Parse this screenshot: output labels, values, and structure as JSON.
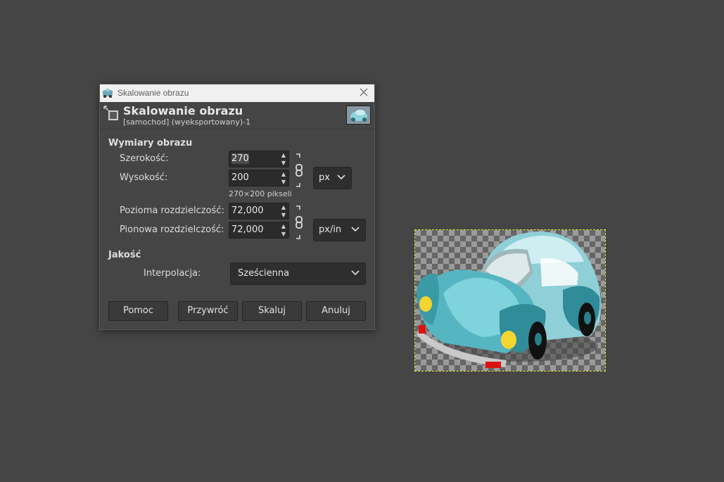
{
  "window": {
    "title": "Skalowanie obrazu"
  },
  "header": {
    "title": "Skalowanie obrazu",
    "subtitle": "[samochod] (wyeksportowany)-1"
  },
  "image_size": {
    "section_label": "Wymiary obrazu",
    "width_label": "Szerokość:",
    "width_value": "270",
    "height_label": "Wysokość:",
    "height_value": "200",
    "unit": "px",
    "pixels_info": "270×200 pikseli",
    "xres_label": "Pozioma rozdzielczość:",
    "xres_value": "72,000",
    "yres_label": "Pionowa rozdzielczość:",
    "yres_value": "72,000",
    "res_unit": "px/in"
  },
  "quality": {
    "section_label": "Jakość",
    "interp_label": "Interpolacja:",
    "interp_value": "Sześcienna"
  },
  "buttons": {
    "help": "Pomoc",
    "reset": "Przywróć",
    "scale": "Skaluj",
    "cancel": "Anuluj"
  },
  "colors": {
    "background": "#454545",
    "titlebar": "#f0f0f0",
    "selection_outline": "#e8e83a"
  }
}
